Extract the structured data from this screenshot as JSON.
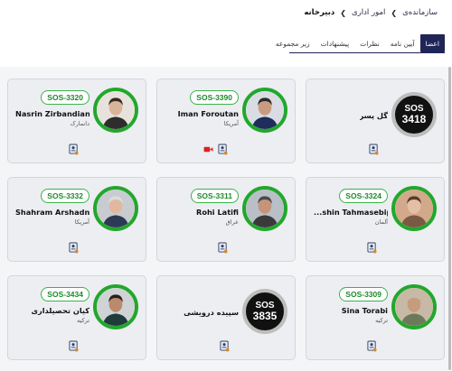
{
  "breadcrumb": {
    "items": [
      "سازمانده‌ی",
      "امور اداری",
      "دبیرخانه"
    ]
  },
  "tabs": [
    "اعضا",
    "آیین نامه",
    "نظرات",
    "پیشنهادات",
    "زیر مجموعه"
  ],
  "active_tab": 0,
  "cards": [
    {
      "kind": "sos",
      "sos_top": "SOS",
      "sos_number": "3418",
      "name": "گل پسر",
      "badge": "",
      "country": "",
      "video": false
    },
    {
      "kind": "photo",
      "badge": "SOS-3390",
      "name": "Iman Foroutan",
      "country": "آمریکا",
      "video": true
    },
    {
      "kind": "photo",
      "badge": "SOS-3320",
      "name": "Nasrin Zirbandian",
      "country": "دانمارک",
      "video": false
    },
    {
      "kind": "photo",
      "badge": "SOS-3324",
      "name": "...shin Tahmasebipour",
      "country": "آلمان",
      "video": false
    },
    {
      "kind": "photo",
      "badge": "SOS-3311",
      "name": "Rohi Latifi",
      "country": "عراق",
      "video": false
    },
    {
      "kind": "photo",
      "badge": "SOS-3332",
      "name": "Shahram Arshadnejad",
      "country": "آمریکا",
      "video": false
    },
    {
      "kind": "photo",
      "badge": "SOS-3309",
      "name": "Sina Torabi",
      "country": "ترکیه",
      "video": false
    },
    {
      "kind": "sos",
      "sos_top": "SOS",
      "sos_number": "3835",
      "name": "سپیده درویشی",
      "badge": "",
      "country": "",
      "video": false
    },
    {
      "kind": "photo",
      "badge": "SOS-3434",
      "name": "کیان تحصیلداری",
      "country": "ترکیه",
      "video": false
    }
  ],
  "colors": {
    "accent": "#1f2557",
    "badge_green": "#3bb34a",
    "avatar_ring": "#22a72c",
    "video_icon": "#e02020"
  }
}
